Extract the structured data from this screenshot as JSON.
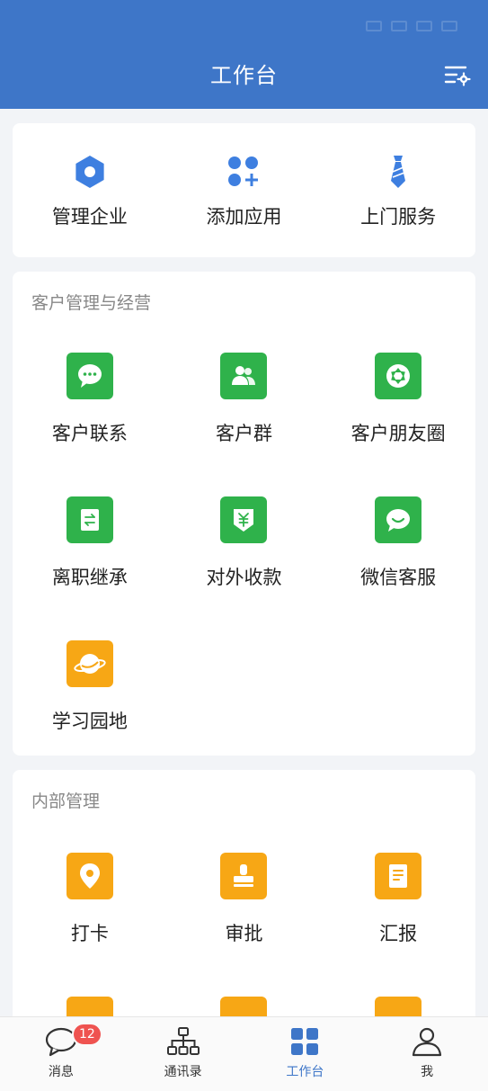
{
  "header": {
    "title": "工作台"
  },
  "quick": [
    {
      "label": "管理企业",
      "icon": "hexagon-icon"
    },
    {
      "label": "添加应用",
      "icon": "add-apps-icon"
    },
    {
      "label": "上门服务",
      "icon": "necktie-icon"
    }
  ],
  "customer": {
    "title": "客户管理与经营",
    "items": [
      {
        "label": "客户联系",
        "icon": "chat-bubble-icon"
      },
      {
        "label": "客户群",
        "icon": "group-icon"
      },
      {
        "label": "客户朋友圈",
        "icon": "aperture-icon"
      },
      {
        "label": "离职继承",
        "icon": "transfer-icon"
      },
      {
        "label": "对外收款",
        "icon": "yuan-icon"
      },
      {
        "label": "微信客服",
        "icon": "service-chat-icon"
      },
      {
        "label": "学习园地",
        "icon": "planet-icon"
      }
    ]
  },
  "internal": {
    "title": "内部管理",
    "items": [
      {
        "label": "打卡",
        "icon": "location-pin-icon"
      },
      {
        "label": "审批",
        "icon": "stamp-icon"
      },
      {
        "label": "汇报",
        "icon": "report-icon"
      }
    ]
  },
  "tabs": [
    {
      "label": "消息",
      "icon": "message-icon",
      "badge": "12"
    },
    {
      "label": "通讯录",
      "icon": "org-chart-icon"
    },
    {
      "label": "工作台",
      "icon": "grid-icon"
    },
    {
      "label": "我",
      "icon": "person-icon"
    }
  ],
  "colors": {
    "header": "#3e76c8",
    "green": "#2fb24b",
    "orange": "#f7a715",
    "accent": "#3e76c8",
    "badge": "#ef5350"
  }
}
